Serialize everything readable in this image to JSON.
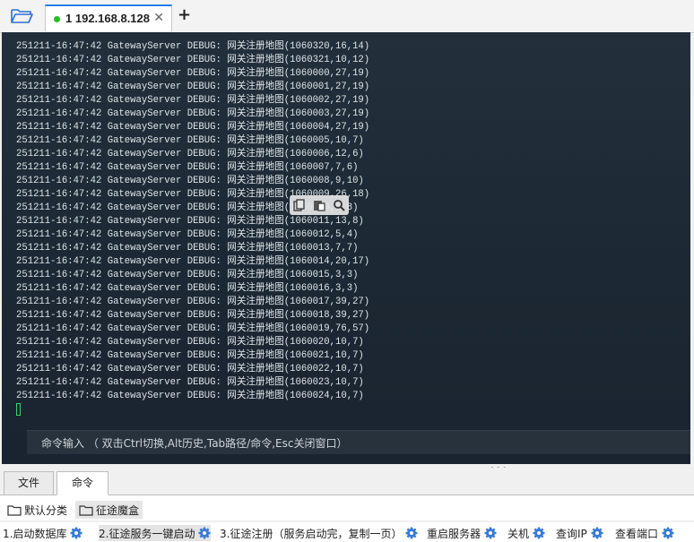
{
  "session_tab": {
    "index": "1",
    "host": "192.168.8.128",
    "status_color": "#20c020"
  },
  "log_lines": [
    "251211-16:47:42 GatewayServer DEBUG: 网关注册地图(1060320,16,14)",
    "251211-16:47:42 GatewayServer DEBUG: 网关注册地图(1060321,10,12)",
    "251211-16:47:42 GatewayServer DEBUG: 网关注册地图(1060000,27,19)",
    "251211-16:47:42 GatewayServer DEBUG: 网关注册地图(1060001,27,19)",
    "251211-16:47:42 GatewayServer DEBUG: 网关注册地图(1060002,27,19)",
    "251211-16:47:42 GatewayServer DEBUG: 网关注册地图(1060003,27,19)",
    "251211-16:47:42 GatewayServer DEBUG: 网关注册地图(1060004,27,19)",
    "251211-16:47:42 GatewayServer DEBUG: 网关注册地图(1060005,10,7)",
    "251211-16:47:42 GatewayServer DEBUG: 网关注册地图(1060006,12,6)",
    "251211-16:47:42 GatewayServer DEBUG: 网关注册地图(1060007,7,6)",
    "251211-16:47:42 GatewayServer DEBUG: 网关注册地图(1060008,9,10)",
    "251211-16:47:42 GatewayServer DEBUG: 网关注册地图(1060009,26,18)",
    "251211-16:47:42 GatewayServer DEBUG: 网关注册地图(1060010,8,8)",
    "251211-16:47:42 GatewayServer DEBUG: 网关注册地图(1060011,13,8)",
    "251211-16:47:42 GatewayServer DEBUG: 网关注册地图(1060012,5,4)",
    "251211-16:47:42 GatewayServer DEBUG: 网关注册地图(1060013,7,7)",
    "251211-16:47:42 GatewayServer DEBUG: 网关注册地图(1060014,20,17)",
    "251211-16:47:42 GatewayServer DEBUG: 网关注册地图(1060015,3,3)",
    "251211-16:47:42 GatewayServer DEBUG: 网关注册地图(1060016,3,3)",
    "251211-16:47:42 GatewayServer DEBUG: 网关注册地图(1060017,39,27)",
    "251211-16:47:42 GatewayServer DEBUG: 网关注册地图(1060018,39,27)",
    "251211-16:47:42 GatewayServer DEBUG: 网关注册地图(1060019,76,57)",
    "251211-16:47:42 GatewayServer DEBUG: 网关注册地图(1060020,10,7)",
    "251211-16:47:42 GatewayServer DEBUG: 网关注册地图(1060021,10,7)",
    "251211-16:47:42 GatewayServer DEBUG: 网关注册地图(1060022,10,7)",
    "251211-16:47:42 GatewayServer DEBUG: 网关注册地图(1060023,10,7)",
    "251211-16:47:42 GatewayServer DEBUG: 网关注册地图(1060024,10,7)"
  ],
  "command_input": {
    "hint": "命令输入 （ 双击Ctrl切换,Alt历史,Tab路径/命令,Esc关闭窗口）"
  },
  "bottom_tabs": {
    "files": "文件",
    "commands": "命令"
  },
  "groups": {
    "default": "默认分类",
    "selected": "征途魔盒"
  },
  "commands": [
    "1.启动数据库",
    "2.征途服务一键启动",
    "3.征途注册（服务启动完，复制一页）",
    "重启服务器",
    "关机",
    "查询IP",
    "查看端口"
  ],
  "colors": {
    "accent": "#2c7be5",
    "terminal_bg": "#1c2833",
    "cursor": "#3fcf6f",
    "gear": "#3a7bd5"
  }
}
